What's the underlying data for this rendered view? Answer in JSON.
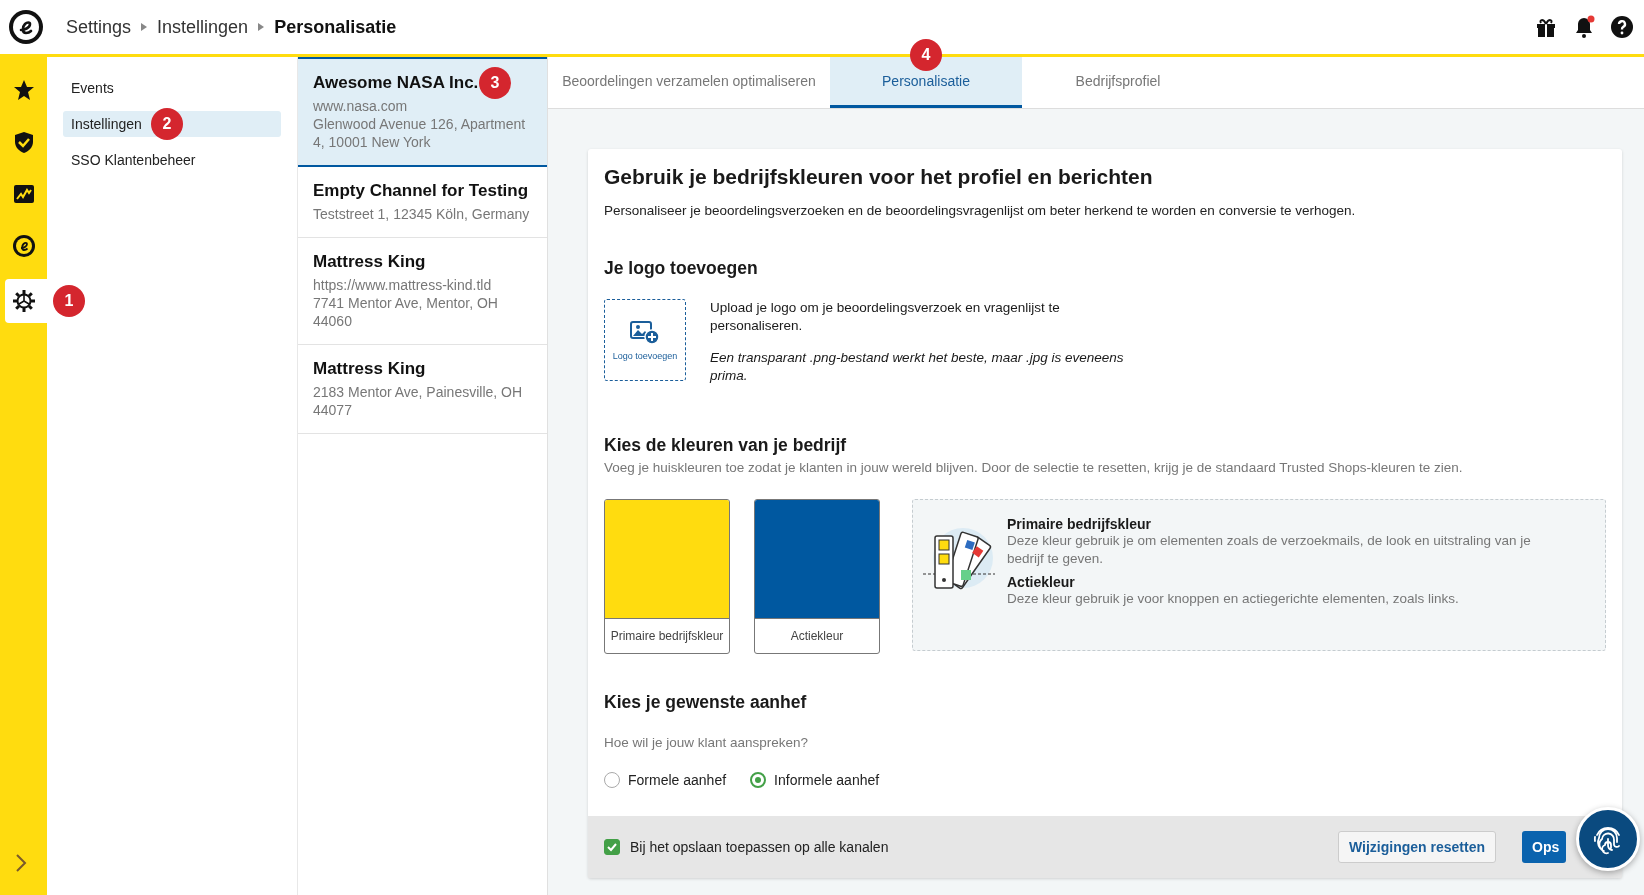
{
  "breadcrumb": [
    {
      "label": "Settings",
      "current": false
    },
    {
      "label": "Instellingen",
      "current": false
    },
    {
      "label": "Personalisatie",
      "current": true
    }
  ],
  "header_icons": [
    {
      "kind": "gift",
      "dot": false
    },
    {
      "kind": "bell",
      "dot": true
    },
    {
      "kind": "help",
      "dot": false
    }
  ],
  "rail": [
    {
      "kind": "star",
      "selected": false
    },
    {
      "kind": "shield",
      "selected": false
    },
    {
      "kind": "chart",
      "selected": false
    },
    {
      "kind": "logo",
      "selected": false
    },
    {
      "kind": "gear",
      "selected": true,
      "marker": "1"
    }
  ],
  "nav": [
    {
      "label": "Events",
      "selected": false
    },
    {
      "label": "Instellingen",
      "selected": true,
      "marker": "2"
    },
    {
      "label": "SSO Klantenbeheer",
      "selected": false
    }
  ],
  "channels": [
    {
      "name": "Awesome NASA Inc.",
      "lines": [
        "www.nasa.com",
        "Glenwood Avenue 126, Apartment 4, 10001 New York"
      ],
      "selected": true,
      "marker": "3"
    },
    {
      "name": "Empty Channel for Testing",
      "lines": [
        "Teststreet 1, 12345 Köln, Germany"
      ],
      "selected": false
    },
    {
      "name": "Mattress King",
      "lines": [
        "https://www.mattress-kind.tld",
        "7741 Mentor Ave, Mentor, OH 44060"
      ],
      "selected": false
    },
    {
      "name": "Mattress King",
      "lines": [
        "2183 Mentor Ave, Painesville, OH 44077"
      ],
      "selected": false
    }
  ],
  "tabs": [
    {
      "label": "Beoordelingen verzamelen optimaliseren",
      "selected": false
    },
    {
      "label": "Personalisatie",
      "selected": true,
      "marker": "4"
    },
    {
      "label": "Bedrijfsprofiel",
      "selected": false
    }
  ],
  "card": {
    "title": "Gebruik je bedrijfskleuren voor het profiel en berichten",
    "intro": "Personaliseer je beoordelingsverzoeken en de beoordelingsvragenlijst om beter herkend te worden en conversie te verhogen.",
    "logo_section": {
      "heading": "Je logo toevoegen",
      "upload_label": "Logo toevoegen",
      "text": "Upload je logo om je beoordelingsverzoek en vragenlijst te personaliseren.",
      "hint": "Een transparant .png-bestand werkt het beste, maar .jpg is eveneens prima."
    },
    "colors_section": {
      "heading": "Kies de kleuren van je bedrijf",
      "text": "Voeg je huiskleuren toe zodat je klanten in jouw wereld blijven. Door de selectie te resetten, krijg je de standaard Trusted Shops-kleuren te zien.",
      "swatches": [
        {
          "label": "Primaire bedrijfskleur",
          "color": "#ffdc0f"
        },
        {
          "label": "Actiekleur",
          "color": "#0058a0"
        }
      ],
      "info": [
        {
          "title": "Primaire bedrijfskleur",
          "text": "Deze kleur gebruik je om elementen zoals de verzoekmails, de look en uitstraling van je bedrijf te geven."
        },
        {
          "title": "Actiekleur",
          "text": "Deze kleur gebruik je voor knoppen en actiegerichte elementen, zoals links."
        }
      ]
    },
    "salutation_section": {
      "heading": "Kies je gewenste aanhef",
      "question": "Hoe wil je jouw klant aanspreken?",
      "options": [
        {
          "label": "Formele aanhef",
          "selected": false
        },
        {
          "label": "Informele aanhef",
          "selected": true
        }
      ]
    },
    "footer": {
      "apply_all": {
        "label": "Bij het opslaan toepassen op alle kanalen",
        "checked": true
      },
      "reset_button": "Wijzigingen resetten",
      "save_button": "Ops"
    }
  }
}
